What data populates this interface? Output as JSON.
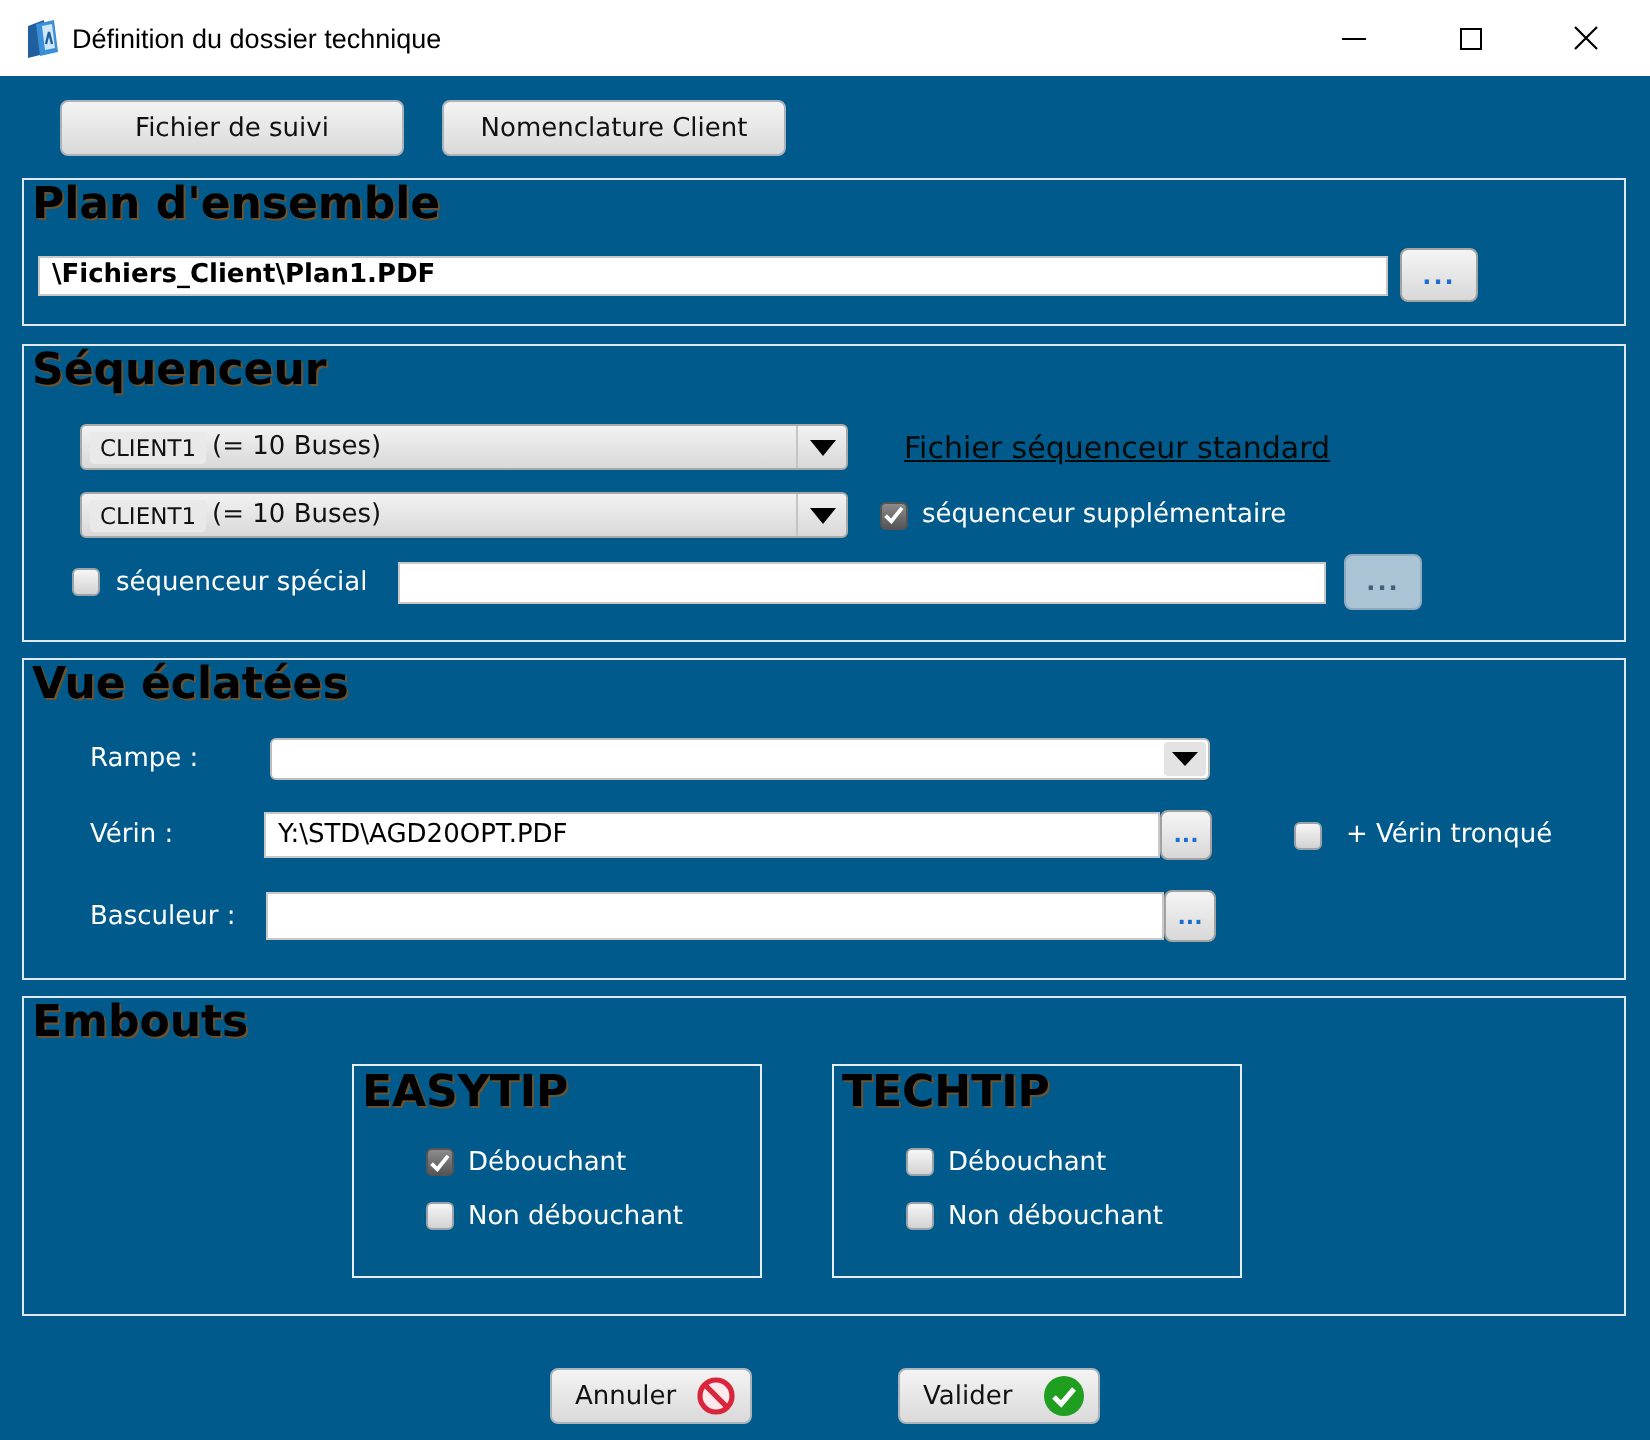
{
  "window": {
    "title": "Définition du dossier technique"
  },
  "top_buttons": [
    {
      "label": "Fichier de suivi"
    },
    {
      "label": "Nomenclature Client"
    }
  ],
  "plan_ensemble": {
    "title": "Plan d'ensemble",
    "file_path": "\\Fichiers_Client\\Plan1.PDF",
    "browse_button": {
      "label": "...",
      "disabled": false
    }
  },
  "sequenceur": {
    "title": "Séquenceur",
    "dropdowns": [
      {
        "code": "CLIENT1",
        "value": "(= 10 Buses)"
      },
      {
        "code": "CLIENT1",
        "value": "(= 10 Buses)"
      }
    ],
    "standard_file_link": "Fichier séquenceur standard",
    "extra_checkbox": {
      "label": "séquenceur supplémentaire",
      "checked": true
    },
    "special_checkbox": {
      "label": "séquenceur spécial",
      "checked": false
    },
    "special_browse_button": {
      "label": "...",
      "disabled": true
    }
  },
  "vue_eclatees": {
    "title": "Vue éclatées",
    "rows": [
      {
        "kind": "dropdown",
        "label": "Rampe :"
      },
      {
        "kind": "file",
        "label": "Vérin :",
        "value": "Y:\\STD\\AGD20OPT.PDF",
        "browse_button": {
          "label": "...",
          "disabled": false
        },
        "option": {
          "label": "+ Vérin tronqué",
          "checked": false
        }
      },
      {
        "kind": "file",
        "label": "Basculeur :",
        "browse_button": {
          "label": "...",
          "disabled": false
        }
      }
    ]
  },
  "embouts": {
    "title": "Embouts",
    "groups": [
      {
        "title": "EASYTIP",
        "options": [
          {
            "label": "Débouchant",
            "checked": true
          },
          {
            "label": "Non débouchant",
            "checked": false
          }
        ]
      },
      {
        "title": "TECHTIP",
        "options": [
          {
            "label": "Débouchant",
            "checked": false
          },
          {
            "label": "Non débouchant",
            "checked": false
          }
        ]
      }
    ]
  },
  "dialog_buttons": [
    {
      "kind": "cancel",
      "label": "Annuler"
    },
    {
      "kind": "ok",
      "label": "Valider"
    }
  ]
}
